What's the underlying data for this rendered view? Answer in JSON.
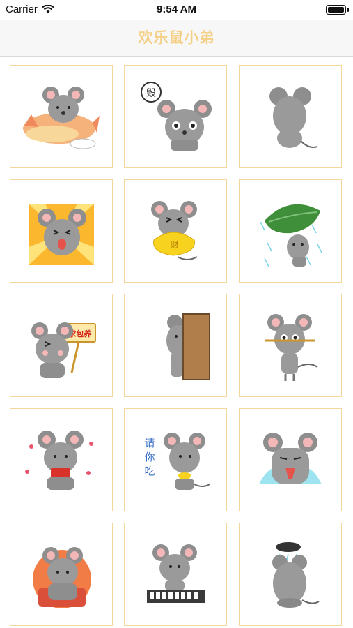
{
  "status_bar": {
    "carrier": "Carrier",
    "time": "9:54 AM"
  },
  "nav": {
    "title": "欢乐鼠小弟"
  },
  "stickers": [
    {
      "icon": "mouse-riding-plane-icon"
    },
    {
      "icon": "mouse-speech-bubble-icon",
      "bubble_text": "毁"
    },
    {
      "icon": "mouse-back-view-icon"
    },
    {
      "icon": "mouse-sunburst-laughing-icon"
    },
    {
      "icon": "mouse-gold-ingot-icon",
      "ingot_text": "财"
    },
    {
      "icon": "mouse-leaf-umbrella-rain-icon"
    },
    {
      "icon": "mouse-holding-sign-icon",
      "sign_text": "求包养"
    },
    {
      "icon": "mouse-peeking-door-icon"
    },
    {
      "icon": "mouse-holding-stick-icon"
    },
    {
      "icon": "mouse-red-envelope-hearts-icon"
    },
    {
      "icon": "mouse-please-eat-icon",
      "side_text": [
        "请",
        "你",
        "吃"
      ]
    },
    {
      "icon": "mouse-crying-icon"
    },
    {
      "icon": "mouse-orange-circle-icon"
    },
    {
      "icon": "mouse-playing-piano-icon"
    },
    {
      "icon": "mouse-rain-cloud-icon"
    }
  ]
}
